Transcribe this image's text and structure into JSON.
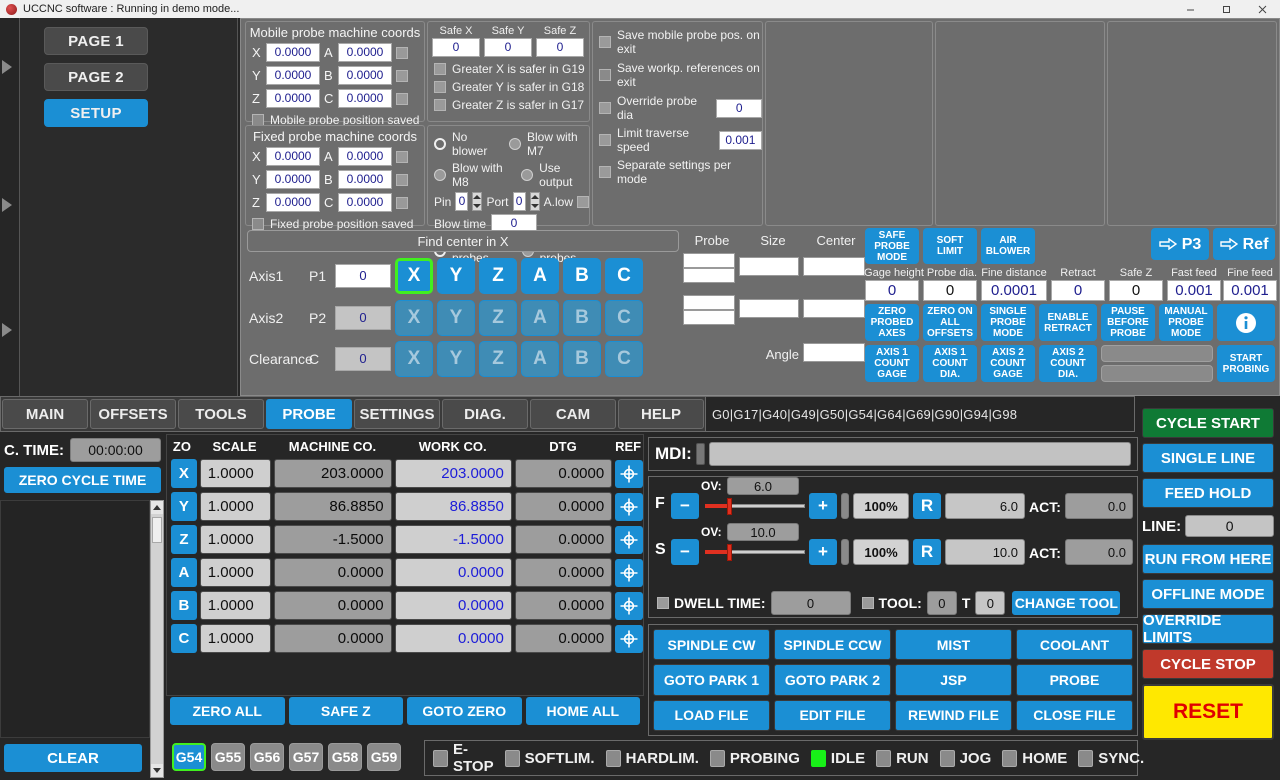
{
  "window": {
    "title": "UCCNC software : Running in demo mode...",
    "minimize": "minimize-icon",
    "maximize": "maximize-icon",
    "close": "close-icon"
  },
  "pages": {
    "buttons": [
      {
        "label": "PAGE 1",
        "active": false
      },
      {
        "label": "PAGE 2",
        "active": false
      },
      {
        "label": "SETUP",
        "active": true
      }
    ]
  },
  "mobile_probe": {
    "title": "Mobile probe machine coords",
    "rows": [
      {
        "axis1": "X",
        "val1": "0.0000",
        "axis2": "A",
        "val2": "0.0000"
      },
      {
        "axis1": "Y",
        "val1": "0.0000",
        "axis2": "B",
        "val2": "0.0000"
      },
      {
        "axis1": "Z",
        "val1": "0.0000",
        "axis2": "C",
        "val2": "0.0000"
      }
    ],
    "saved_label": "Mobile probe position saved"
  },
  "fixed_probe": {
    "title": "Fixed probe machine coords",
    "rows": [
      {
        "axis1": "X",
        "val1": "0.0000",
        "axis2": "A",
        "val2": "0.0000"
      },
      {
        "axis1": "Y",
        "val1": "0.0000",
        "axis2": "B",
        "val2": "0.0000"
      },
      {
        "axis1": "Z",
        "val1": "0.0000",
        "axis2": "C",
        "val2": "0.0000"
      }
    ],
    "saved_label": "Fixed probe position saved"
  },
  "safe_coords": {
    "headers": [
      "Safe X",
      "Safe Y",
      "Safe Z"
    ],
    "values": [
      "0",
      "0",
      "0"
    ],
    "checks": [
      "Greater X is safer in G19",
      "Greater Y is safer in G18",
      "Greater Z is safer in G17"
    ]
  },
  "blower": {
    "options": [
      {
        "label": "No blower",
        "selected": true
      },
      {
        "label": "Blow with M7",
        "selected": false
      },
      {
        "label": "Blow with M8",
        "selected": false
      },
      {
        "label": "Use output",
        "selected": false
      }
    ],
    "pin_label": "Pin",
    "pin_value": "0",
    "port_label": "Port",
    "port_value": "0",
    "alow_label": "A.low",
    "blowtime_label": "Blow time",
    "blowtime_value": "0",
    "probe_scope": [
      {
        "label": "Tool probes",
        "selected": true
      },
      {
        "label": "All probes",
        "selected": false
      }
    ]
  },
  "settings_checks": {
    "items": [
      {
        "label": "Save mobile probe pos. on exit",
        "value": null
      },
      {
        "label": "Save workp. references on exit",
        "value": null
      },
      {
        "label": "Override probe dia",
        "value": "0"
      },
      {
        "label": "Limit traverse speed",
        "value": "0.001"
      },
      {
        "label": "Separate settings per mode",
        "value": null
      }
    ]
  },
  "find_center": {
    "title": "Find center in X",
    "rows": [
      {
        "name": "Axis1",
        "pname": "P1",
        "pvalue": "0",
        "selected_axis": "X",
        "enabled": true
      },
      {
        "name": "Axis2",
        "pname": "P2",
        "pvalue": "0",
        "selected_axis": null,
        "enabled": false
      },
      {
        "name": "Clearance",
        "pname": "C",
        "pvalue": "0",
        "selected_axis": null,
        "enabled": false
      }
    ],
    "axis_letters": [
      "X",
      "Y",
      "Z",
      "A",
      "B",
      "C"
    ]
  },
  "probe_results": {
    "headers": [
      "Probe",
      "Size",
      "Center"
    ],
    "angle_label": "Angle"
  },
  "probe_toolbar": {
    "top_buttons": [
      "SAFE PROBE MODE",
      "SOFT LIMIT",
      "AIR BLOWER"
    ],
    "nav_buttons": [
      "P3",
      "Ref"
    ],
    "fields": [
      {
        "label": "Gage height",
        "value": "0"
      },
      {
        "label": "Probe dia.",
        "value": "0"
      },
      {
        "label": "Fine distance",
        "value": "0.0001"
      },
      {
        "label": "Retract",
        "value": "0"
      },
      {
        "label": "Safe Z",
        "value": "0"
      },
      {
        "label": "Fast feed",
        "value": "0.001"
      },
      {
        "label": "Fine feed",
        "value": "0.001"
      }
    ],
    "mid_buttons": [
      "ZERO PROBED AXES",
      "ZERO ON ALL OFFSETS",
      "SINGLE PROBE MODE",
      "ENABLE RETRACT",
      "PAUSE BEFORE PROBE",
      "MANUAL PROBE MODE"
    ],
    "info_icon": "info-icon",
    "bottom_buttons": [
      "AXIS 1 COUNT GAGE",
      "AXIS 1 COUNT DIA.",
      "AXIS 2 COUNT GAGE",
      "AXIS 2 COUNT DIA."
    ],
    "start_button": "START PROBING"
  },
  "tabs": [
    {
      "label": "MAIN",
      "active": false
    },
    {
      "label": "OFFSETS",
      "active": false
    },
    {
      "label": "TOOLS",
      "active": false
    },
    {
      "label": "PROBE",
      "active": true
    },
    {
      "label": "SETTINGS",
      "active": false
    },
    {
      "label": "DIAG.",
      "active": false
    },
    {
      "label": "CAM",
      "active": false
    },
    {
      "label": "HELP",
      "active": false
    }
  ],
  "gcode_status": "G0|G17|G40|G49|G50|G54|G64|G69|G90|G94|G98",
  "cycle_time": {
    "label": "C. TIME:",
    "value": "00:00:00",
    "zero_button": "ZERO CYCLE TIME",
    "clear_button": "CLEAR"
  },
  "dro": {
    "headers": [
      "ZO",
      "SCALE",
      "MACHINE CO.",
      "WORK CO.",
      "DTG",
      "REF"
    ],
    "rows": [
      {
        "axis": "X",
        "scale": "1.0000",
        "machine": "203.0000",
        "work": "203.0000",
        "dtg": "0.0000"
      },
      {
        "axis": "Y",
        "scale": "1.0000",
        "machine": "86.8850",
        "work": "86.8850",
        "dtg": "0.0000"
      },
      {
        "axis": "Z",
        "scale": "1.0000",
        "machine": "-1.5000",
        "work": "-1.5000",
        "dtg": "0.0000"
      },
      {
        "axis": "A",
        "scale": "1.0000",
        "machine": "0.0000",
        "work": "0.0000",
        "dtg": "0.0000"
      },
      {
        "axis": "B",
        "scale": "1.0000",
        "machine": "0.0000",
        "work": "0.0000",
        "dtg": "0.0000"
      },
      {
        "axis": "C",
        "scale": "1.0000",
        "machine": "0.0000",
        "work": "0.0000",
        "dtg": "0.0000"
      }
    ],
    "zero_buttons": [
      "ZERO ALL",
      "SAFE Z",
      "GOTO ZERO",
      "HOME ALL"
    ],
    "offsets": [
      {
        "label": "G54",
        "selected": true
      },
      {
        "label": "G55",
        "selected": false
      },
      {
        "label": "G56",
        "selected": false
      },
      {
        "label": "G57",
        "selected": false
      },
      {
        "label": "G58",
        "selected": false
      },
      {
        "label": "G59",
        "selected": false
      }
    ]
  },
  "mdi": {
    "label": "MDI:",
    "value": "",
    "placeholder": ""
  },
  "overrides": {
    "feed": {
      "axis": "F",
      "ov_label": "OV:",
      "ov_value": "6.0",
      "minus": "−",
      "plus": "+",
      "percent": "100%",
      "reset": "R",
      "value": "6.0",
      "act_label": "ACT:",
      "act_value": "0.0",
      "slider_pct": 22
    },
    "spindle": {
      "axis": "S",
      "ov_label": "OV:",
      "ov_value": "10.0",
      "minus": "−",
      "plus": "+",
      "percent": "100%",
      "reset": "R",
      "value": "10.0",
      "act_label": "ACT:",
      "act_value": "0.0",
      "slider_pct": 22
    },
    "dwell_label": "DWELL TIME:",
    "dwell_value": "0",
    "tool_label": "TOOL:",
    "tool_value": "0",
    "t_label": "T",
    "t_value": "0",
    "change_tool": "CHANGE TOOL"
  },
  "action_buttons": [
    "SPINDLE CW",
    "SPINDLE CCW",
    "MIST",
    "COOLANT",
    "GOTO PARK 1",
    "GOTO PARK 2",
    "JSP",
    "PROBE",
    "LOAD FILE",
    "EDIT FILE",
    "REWIND FILE",
    "CLOSE FILE"
  ],
  "status_leds": [
    {
      "label": "E-STOP",
      "on": false
    },
    {
      "label": "SOFTLIM.",
      "on": false
    },
    {
      "label": "HARDLIM.",
      "on": false
    },
    {
      "label": "PROBING",
      "on": false
    },
    {
      "label": "IDLE",
      "on": true
    },
    {
      "label": "RUN",
      "on": false
    },
    {
      "label": "JOG",
      "on": false
    },
    {
      "label": "HOME",
      "on": false
    },
    {
      "label": "SYNC.",
      "on": false
    }
  ],
  "right_panel": {
    "cycle_start": "CYCLE START",
    "single_line": "SINGLE LINE",
    "feed_hold": "FEED HOLD",
    "line_label": "LINE:",
    "line_value": "0",
    "run_from_here": "RUN FROM HERE",
    "offline_mode": "OFFLINE MODE",
    "override_limits": "OVERRIDE LIMITS",
    "cycle_stop": "CYCLE STOP",
    "reset": "RESET"
  }
}
